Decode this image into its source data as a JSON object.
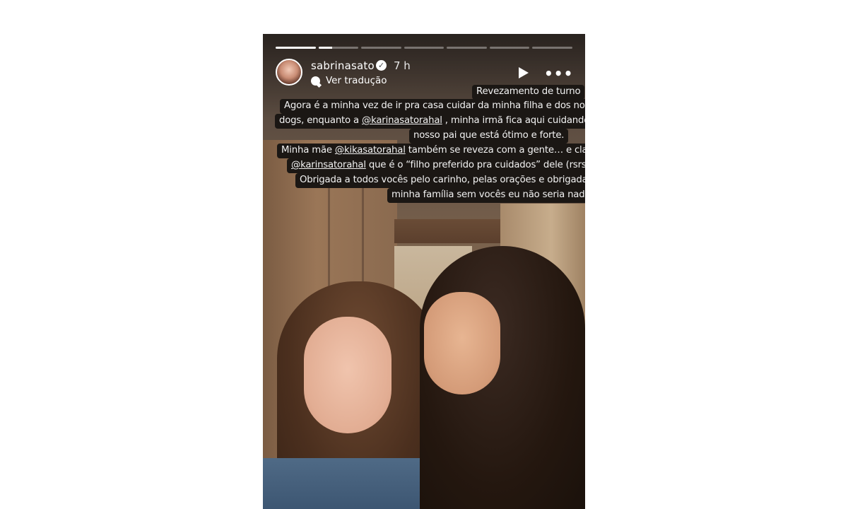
{
  "story": {
    "progress": {
      "segments": 7,
      "current_index": 1,
      "current_fill": 0.35
    },
    "user": {
      "username": "sabrinasato",
      "verified_icon": "verified-badge-icon",
      "time": "7 h"
    },
    "translate": {
      "icon": "translate-icon",
      "label": "Ver tradução"
    },
    "controls": {
      "play_icon": "play-icon",
      "more_icon": "more-icon",
      "more_glyph": "•••"
    },
    "caption": {
      "title": "Revezamento de turno",
      "line1": "Agora é a minha vez de ir pra casa cuidar da minha filha e dos nossos",
      "line2a": "dogs, enquanto a ",
      "mention1": "@karinasatorahal",
      "line2b": " , minha irmã fica aqui cuidando do",
      "line3": "nosso pai que está ótimo e forte.",
      "line4a": "Minha mãe ",
      "mention2": "@kikasatorahal",
      "line4b": " também se reveza com a gente… e claro, o",
      "mention3": "@karinsatorahal",
      "line5b": " que é o “filho preferido pra cuidados” dele (rsrs).",
      "line6": "Obrigada a todos vocês pelo carinho, pelas orações e obrigada à",
      "line7": "minha família sem vocês eu não seria nada."
    }
  }
}
